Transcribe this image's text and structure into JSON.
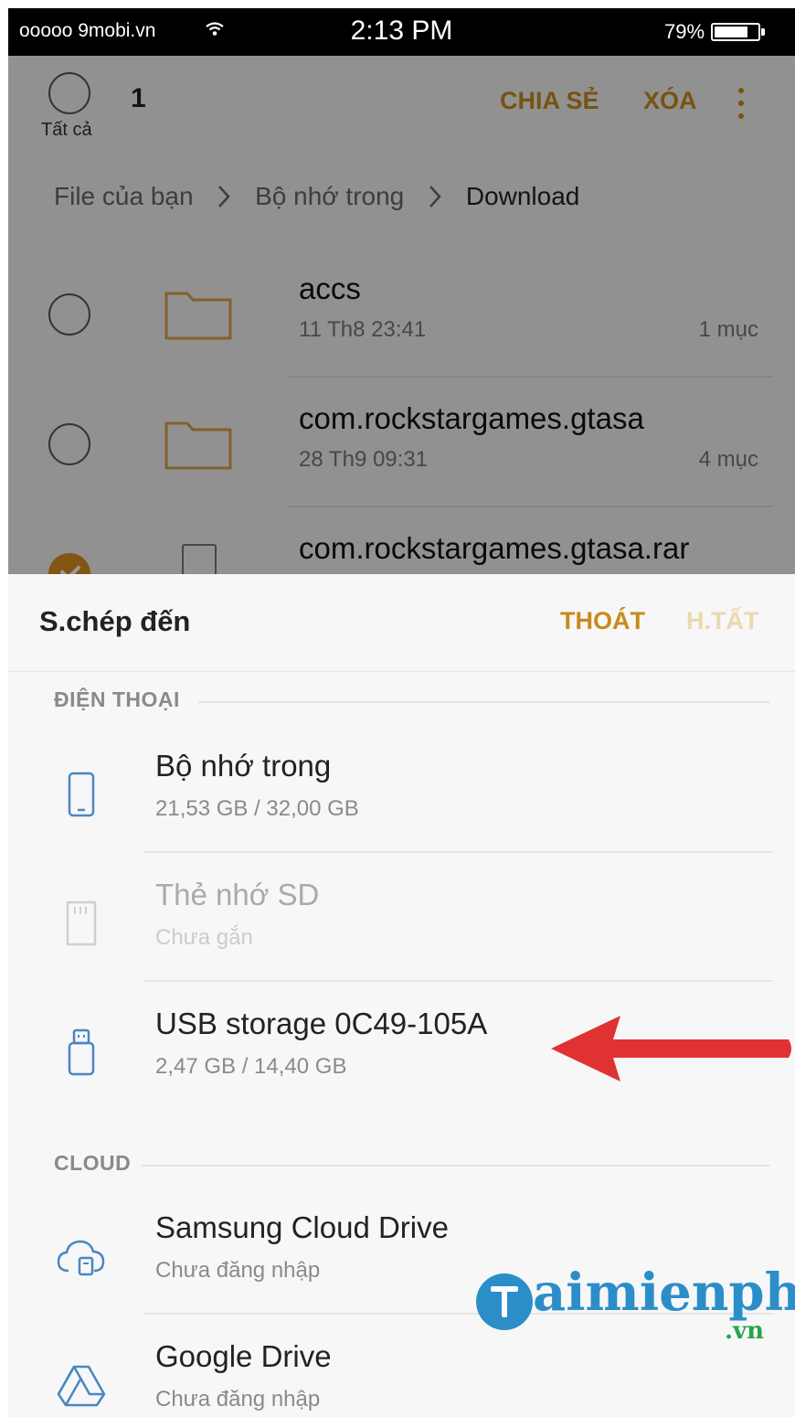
{
  "status_bar": {
    "carrier": "ooooo 9mobi.vn",
    "time": "2:13 PM",
    "battery_percent": "79%",
    "battery_level": 0.79
  },
  "selection_bar": {
    "select_all_label": "Tất cả",
    "selected_count": "1",
    "share_label": "CHIA SẺ",
    "delete_label": "XÓA",
    "more_icon": "more-vertical-icon"
  },
  "breadcrumb": [
    "File của bạn",
    "Bộ nhớ trong",
    "Download"
  ],
  "files": [
    {
      "name": "accs",
      "date": "11 Th8 23:41",
      "count": "1 mục",
      "type": "folder",
      "checked": false
    },
    {
      "name": "com.rockstargames.gtasa",
      "date": "28 Th9 09:31",
      "count": "4 mục",
      "type": "folder",
      "checked": false
    },
    {
      "name": "com.rockstargames.gtasa.rar",
      "date": "",
      "count": "",
      "type": "file",
      "checked": true
    }
  ],
  "sheet": {
    "title": "S.chép đến",
    "cancel_label": "THOÁT",
    "done_label": "H.TẤT",
    "sections": [
      {
        "label": "ĐIỆN THOẠI",
        "items": [
          {
            "title": "Bộ nhớ trong",
            "subtitle": "21,53 GB / 32,00 GB",
            "icon": "phone-icon",
            "enabled": true
          },
          {
            "title": "Thẻ nhớ SD",
            "subtitle": "Chưa gắn",
            "icon": "sd-card-icon",
            "enabled": false
          },
          {
            "title": "USB storage 0C49-105A",
            "subtitle": "2,47 GB / 14,40 GB",
            "icon": "usb-icon",
            "enabled": true
          }
        ]
      },
      {
        "label": "CLOUD",
        "items": [
          {
            "title": "Samsung Cloud Drive",
            "subtitle": "Chưa đăng nhập",
            "icon": "cloud-icon",
            "enabled": true
          },
          {
            "title": "Google Drive",
            "subtitle": "Chưa đăng nhập",
            "icon": "google-drive-icon",
            "enabled": true
          }
        ]
      }
    ]
  },
  "watermark": {
    "brand": "aimienphi",
    "tld": ".vn"
  },
  "colors": {
    "accent": "#c98a1c",
    "icon_blue": "#4a86c5",
    "arrow_red": "#e03232",
    "watermark_blue": "#2b8ec9",
    "watermark_green": "#26a54a"
  }
}
